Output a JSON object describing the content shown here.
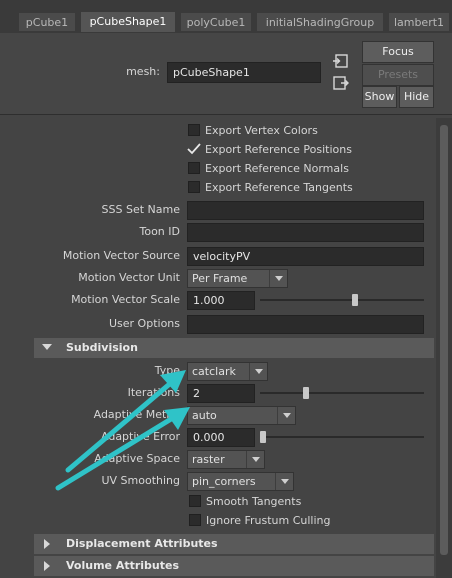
{
  "tabs": [
    "pCube1",
    "pCubeShape1",
    "polyCube1",
    "initialShadingGroup",
    "lambert1"
  ],
  "header": {
    "mesh_label": "mesh:",
    "mesh_value": "pCubeShape1",
    "focus": "Focus",
    "presets": "Presets",
    "show": "Show",
    "hide": "Hide"
  },
  "exports": {
    "vertex_colors": "Export Vertex Colors",
    "ref_positions": "Export Reference Positions",
    "ref_normals": "Export Reference Normals",
    "ref_tangents": "Export Reference Tangents"
  },
  "attrs": {
    "sss_set_name": "SSS Set Name",
    "toon_id": "Toon ID",
    "mv_source": "Motion Vector Source",
    "mv_source_value": "velocityPV",
    "mv_unit": "Motion Vector Unit",
    "mv_unit_value": "Per Frame",
    "mv_scale": "Motion Vector Scale",
    "mv_scale_value": "1.000",
    "mv_scale_slider": 0.58,
    "user_options": "User Options"
  },
  "subdivision": {
    "title": "Subdivision",
    "type_label": "Type",
    "type_value": "catclark",
    "iterations_label": "Iterations",
    "iterations_value": "2",
    "iterations_slider": 0.27,
    "adaptive_metric_label": "Adaptive Metric",
    "adaptive_metric_value": "auto",
    "adaptive_error_label": "Adaptive Error",
    "adaptive_error_value": "0.000",
    "adaptive_error_slider": 0.0,
    "adaptive_space_label": "Adaptive Space",
    "adaptive_space_value": "raster",
    "uv_smoothing_label": "UV Smoothing",
    "uv_smoothing_value": "pin_corners",
    "smooth_tangents": "Smooth Tangents",
    "ignore_frustum": "Ignore Frustum Culling"
  },
  "sections": {
    "displacement": "Displacement Attributes",
    "volume": "Volume Attributes"
  },
  "colors": {
    "arrow": "#2fc3c8",
    "bg": "#444444"
  }
}
